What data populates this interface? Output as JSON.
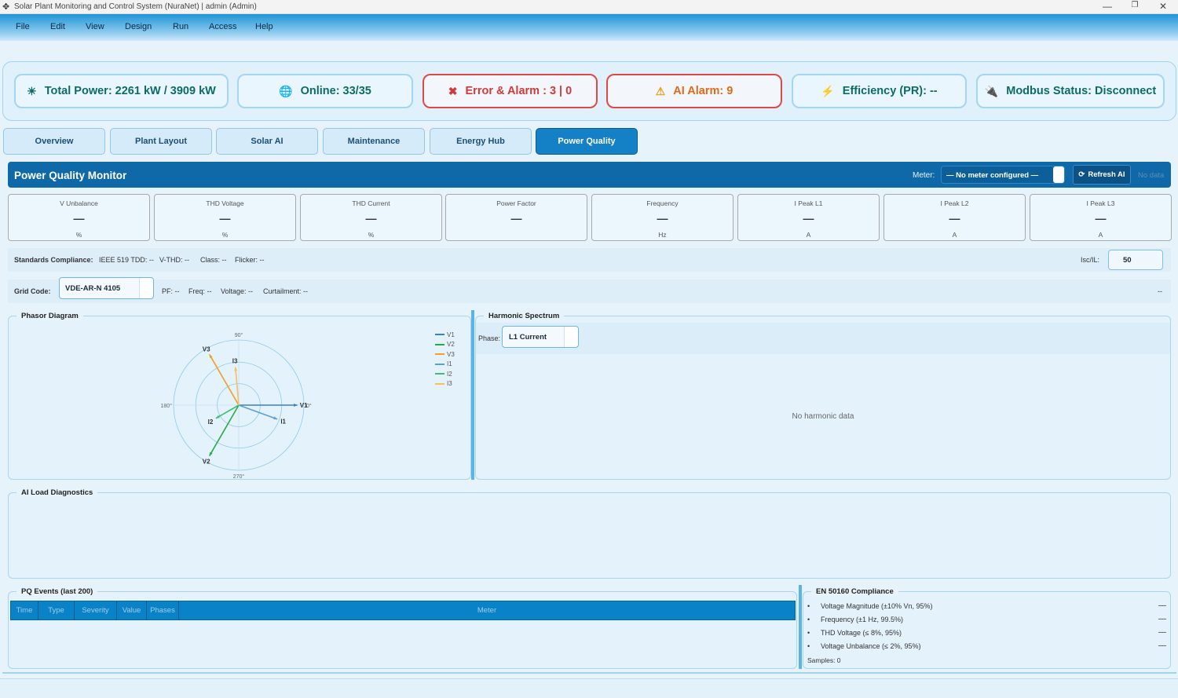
{
  "window": {
    "title": "Solar Plant Monitoring and Control System (NuraNet) | admin (Admin)",
    "minimize": "—",
    "restore": "❐",
    "close": "✕"
  },
  "menu": [
    "File",
    "Edit",
    "View",
    "Design",
    "Run",
    "Access",
    "Help"
  ],
  "stats": {
    "total_power": "Total Power: 2261 kW / 3909 kW",
    "online": "Online: 33/35",
    "error_alarm": "Error & Alarm : 3 | 0",
    "ai_alarm": "AI Alarm: 9",
    "efficiency": "Efficiency (PR): --",
    "modbus": "Modbus Status: Disconnect"
  },
  "tabs": [
    "Overview",
    "Plant Layout",
    "Solar AI",
    "Maintenance",
    "Energy Hub",
    "Power Quality"
  ],
  "active_tab": "Power Quality",
  "pq": {
    "title": "Power Quality Monitor",
    "meter_label": "Meter:",
    "meter_value": "— No meter configured —",
    "refresh_label": "Refresh AI",
    "refresh_icon": "⟳",
    "no_data": "No data"
  },
  "metrics": [
    {
      "label": "V Unbalance",
      "value": "—",
      "unit": "%"
    },
    {
      "label": "THD Voltage",
      "value": "—",
      "unit": "%"
    },
    {
      "label": "THD Current",
      "value": "—",
      "unit": "%"
    },
    {
      "label": "Power Factor",
      "value": "—",
      "unit": ""
    },
    {
      "label": "Frequency",
      "value": "—",
      "unit": "Hz"
    },
    {
      "label": "I Peak  L1",
      "value": "—",
      "unit": "A"
    },
    {
      "label": "I Peak  L2",
      "value": "—",
      "unit": "A"
    },
    {
      "label": "I Peak  L3",
      "value": "—",
      "unit": "A"
    }
  ],
  "compliance": {
    "label": "Standards Compliance:",
    "ieee": "IEEE 519 TDD: --",
    "vthd": "V-THD: --",
    "class": "Class: --",
    "flicker": "Flicker: --",
    "isc_label": "Isc/IL:",
    "isc_value": "50"
  },
  "gridcode": {
    "label": "Grid Code:",
    "value": "VDE-AR-N 4105",
    "pf": "PF: --",
    "freq": "Freq: --",
    "voltage": "Voltage: --",
    "curtailment": "Curtailment: --",
    "right": "--"
  },
  "phasor": {
    "title": "Phasor Diagram",
    "angle_labels": [
      "90°",
      "0°",
      "270°",
      "180°"
    ],
    "phasors": [
      {
        "name": "V1",
        "angle_deg": 0,
        "magnitude": 1.0,
        "color": "#3b7fc4"
      },
      {
        "name": "V2",
        "angle_deg": 240,
        "magnitude": 1.0,
        "color": "#2aa84a"
      },
      {
        "name": "V3",
        "angle_deg": 120,
        "magnitude": 1.0,
        "color": "#f0a020"
      },
      {
        "name": "I1",
        "angle_deg": -20,
        "magnitude": 0.7,
        "color": "#5aa0d8"
      },
      {
        "name": "I2",
        "angle_deg": 210,
        "magnitude": 0.45,
        "color": "#3cc070"
      },
      {
        "name": "I3",
        "angle_deg": 95,
        "magnitude": 0.65,
        "color": "#f5c060"
      }
    ],
    "legend": [
      "V1",
      "V2",
      "V3",
      "I1",
      "I2",
      "I3"
    ]
  },
  "harmonic": {
    "title": "Harmonic Spectrum",
    "phase_label": "Phase:",
    "phase_value": "L1 Current",
    "empty": "No harmonic data"
  },
  "ai_load": {
    "title": "AI Load Diagnostics"
  },
  "events": {
    "title": "PQ Events (last 200)",
    "columns": [
      "Time",
      "Type",
      "Severity",
      "Value",
      "Phases",
      "Meter"
    ]
  },
  "en50160": {
    "title": "EN 50160 Compliance",
    "items": [
      {
        "text": "Voltage Magnitude (±10% Vn, 95%)",
        "status": "—"
      },
      {
        "text": "Frequency (±1 Hz, 99.5%)",
        "status": "—"
      },
      {
        "text": "THD Voltage (≤ 8%, 95%)",
        "status": "—"
      },
      {
        "text": "Voltage Unbalance (≤ 2%, 95%)",
        "status": "—"
      }
    ],
    "samples": "Samples: 0"
  },
  "icons": {
    "app": "app-logo-icon",
    "sun": "sun-icon",
    "globe": "globe-icon",
    "error": "x-icon",
    "warning": "warning-icon",
    "bolt": "bolt-icon",
    "plug": "plug-icon",
    "refresh": "refresh-icon"
  }
}
